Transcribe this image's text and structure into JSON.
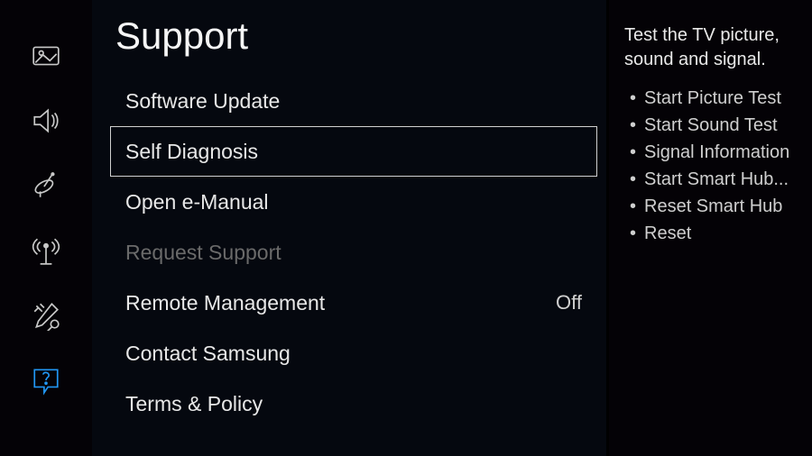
{
  "sidebar": {
    "items": [
      {
        "name": "picture-icon"
      },
      {
        "name": "sound-icon"
      },
      {
        "name": "broadcasting-icon"
      },
      {
        "name": "network-icon"
      },
      {
        "name": "system-icon"
      },
      {
        "name": "support-icon"
      }
    ]
  },
  "main": {
    "title": "Support",
    "items": [
      {
        "label": "Software Update",
        "value": "",
        "state": "normal"
      },
      {
        "label": "Self Diagnosis",
        "value": "",
        "state": "selected"
      },
      {
        "label": "Open e-Manual",
        "value": "",
        "state": "normal"
      },
      {
        "label": "Request Support",
        "value": "",
        "state": "disabled"
      },
      {
        "label": "Remote Management",
        "value": "Off",
        "state": "normal"
      },
      {
        "label": "Contact Samsung",
        "value": "",
        "state": "normal"
      },
      {
        "label": "Terms & Policy",
        "value": "",
        "state": "normal"
      }
    ]
  },
  "detail": {
    "description": "Test the TV picture, sound and signal.",
    "bullets": [
      "Start Picture Test",
      "Start Sound Test",
      "Signal Information",
      "Start Smart Hub...",
      "Reset Smart Hub",
      "Reset"
    ]
  },
  "colors": {
    "accent": "#2196f3",
    "panelBg": "#05080f"
  }
}
